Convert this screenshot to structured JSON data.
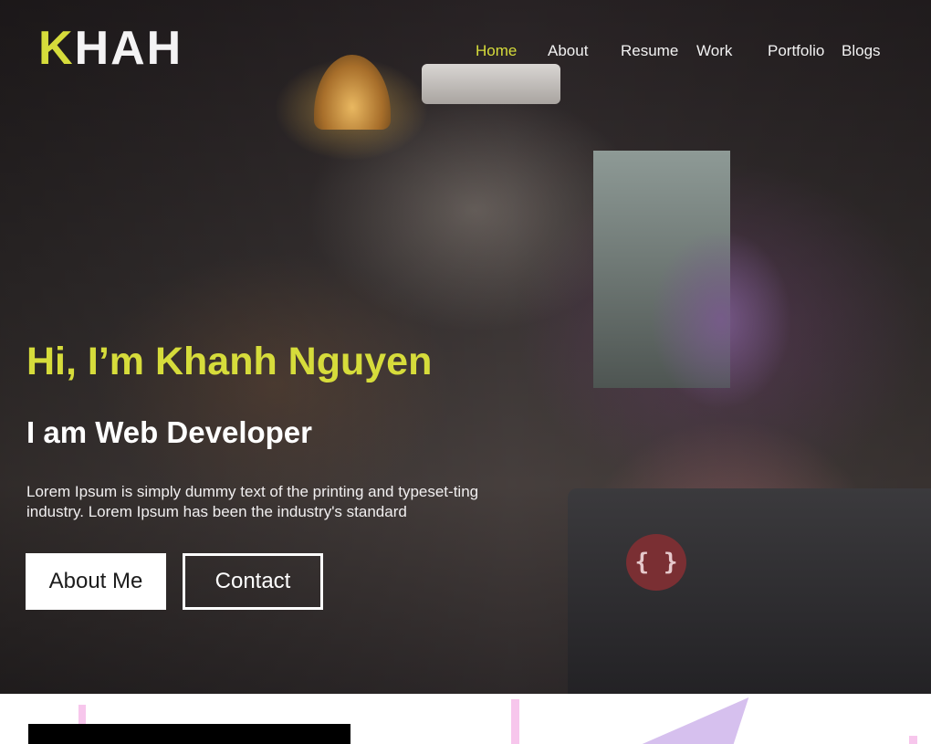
{
  "brand": {
    "accent": "K",
    "rest": "HAH",
    "accent_color": "#d6dc3b"
  },
  "nav": {
    "items": [
      {
        "label": "Home",
        "active": true
      },
      {
        "label": "About",
        "active": false
      },
      {
        "label": "Resume",
        "active": false
      },
      {
        "label": "Work",
        "active": false
      },
      {
        "label": "Portfolio",
        "active": false
      },
      {
        "label": "Blogs",
        "active": false
      }
    ]
  },
  "hero": {
    "title": "Hi, I’m Khanh Nguyen",
    "subtitle": "I am Web Developer",
    "description": "Lorem Ipsum is simply dummy text of the printing and typeset-ting industry. Lorem Ipsum has been the industry's standard",
    "primary_button": "About Me",
    "secondary_button": "Contact",
    "laptop_badge_icon": "code-braces-icon",
    "laptop_badge_text": "{ }"
  },
  "colors": {
    "accent": "#d6dc3b",
    "text_light": "#ffffff",
    "decor_pink": "#f7c6ec",
    "decor_lavender": "#d6c0ee"
  }
}
